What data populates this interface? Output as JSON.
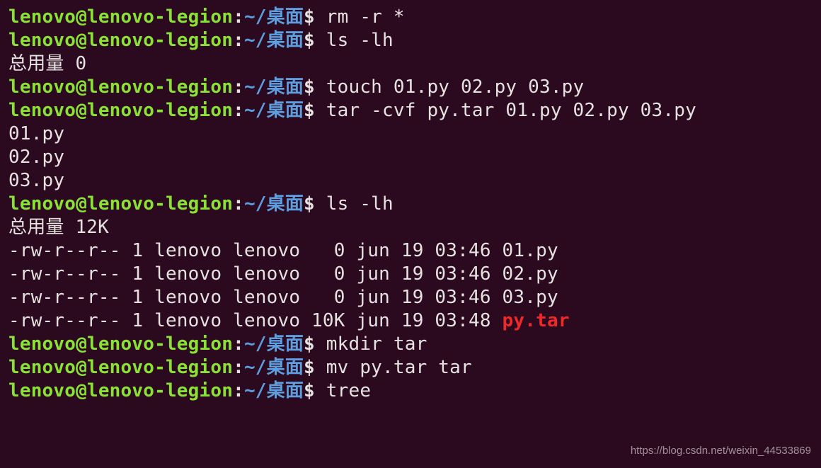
{
  "prompt": {
    "user_host": "lenovo@lenovo-legion",
    "colon": ":",
    "path": "~/桌面",
    "dollar": "$"
  },
  "lines": [
    {
      "type": "prompt",
      "cmd": "rm -r *"
    },
    {
      "type": "prompt",
      "cmd": "ls -lh"
    },
    {
      "type": "out",
      "text": "总用量 0"
    },
    {
      "type": "prompt",
      "cmd": "touch 01.py 02.py 03.py"
    },
    {
      "type": "prompt",
      "cmd": "tar -cvf py.tar 01.py 02.py 03.py"
    },
    {
      "type": "out",
      "text": "01.py"
    },
    {
      "type": "out",
      "text": "02.py"
    },
    {
      "type": "out",
      "text": "03.py"
    },
    {
      "type": "prompt",
      "cmd": "ls -lh"
    },
    {
      "type": "out",
      "text": "总用量 12K"
    },
    {
      "type": "out",
      "text": "-rw-r--r-- 1 lenovo lenovo   0 jun 19 03:46 01.py"
    },
    {
      "type": "out",
      "text": "-rw-r--r-- 1 lenovo lenovo   0 jun 19 03:46 02.py"
    },
    {
      "type": "out",
      "text": "-rw-r--r-- 1 lenovo lenovo   0 jun 19 03:46 03.py"
    },
    {
      "type": "out_redfile",
      "prefix": "-rw-r--r-- 1 lenovo lenovo 10K jun 19 03:48 ",
      "redfile": "py.tar"
    },
    {
      "type": "prompt",
      "cmd": "mkdir tar"
    },
    {
      "type": "prompt",
      "cmd": "mv py.tar tar"
    },
    {
      "type": "prompt",
      "cmd": "tree"
    }
  ],
  "watermark": "https://blog.csdn.net/weixin_44533869"
}
